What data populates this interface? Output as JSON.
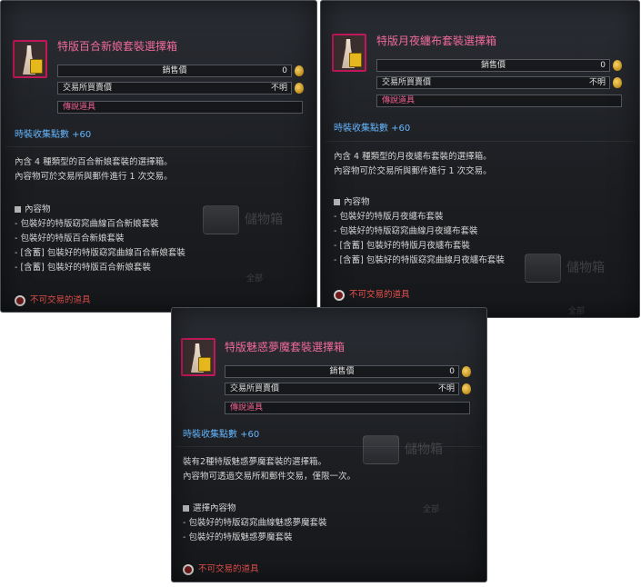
{
  "tooltips": [
    {
      "title": "特版百合新娘套裝選擇箱",
      "sell_price_label": "銷售價",
      "sell_price": "0",
      "exchange_price_label": "交易所買賣價",
      "exchange_price": "不明",
      "grade": "傳說道具",
      "fashion_points": "時裝收集點數 +60",
      "desc_lines": [
        "內含 4 種類型的百合新娘套裝的選擇箱。",
        "內容物可於交易所與郵件進行 1 次交易。"
      ],
      "contents_header": "內容物",
      "contents": [
        "- 包裝好的特版窈窕曲線百合新娘套裝",
        "- 包裝好的特版百合新娘套裝",
        "- [含蓄] 包裝好的特版窈窕曲線百合新娘套裝",
        "- [含蓄] 包裝好的特版百合新娘套裝"
      ],
      "untradeable": "不可交易的道具"
    },
    {
      "title": "特版月夜纏布套裝選擇箱",
      "sell_price_label": "銷售價",
      "sell_price": "0",
      "exchange_price_label": "交易所買賣價",
      "exchange_price": "不明",
      "grade": "傳說道具",
      "fashion_points": "時裝收集點數 +60",
      "desc_lines": [
        "內含 4 種類型的月夜纏布套裝的選擇箱。",
        "內容物可於交易所與郵件進行 1 次交易。"
      ],
      "contents_header": "內容物",
      "contents": [
        "- 包裝好的特版月夜纏布套裝",
        "- 包裝好的特版窈窕曲線月夜纏布套裝",
        "- [含蓄] 包裝好的特版月夜纏布套裝",
        "- [含蓄] 包裝好的特版窈窕曲線月夜纏布套裝"
      ],
      "untradeable": "不可交易的道具"
    },
    {
      "title": "特版魅惑夢魔套裝選擇箱",
      "sell_price_label": "銷售價",
      "sell_price": "0",
      "exchange_price_label": "交易所買賣價",
      "exchange_price": "不明",
      "grade": "傳說道具",
      "fashion_points": "時裝收集點數 +60",
      "desc_lines": [
        "裝有2種特版魅惑夢魔套裝的選擇箱。",
        "內容物可透過交易所和郵件交易，僅限一次。"
      ],
      "contents_header": "選擇內容物",
      "contents": [
        "- 包裝好的特版窈窕曲線魅惑夢魔套裝",
        "- 包裝好的特版魅惑夢魔套裝"
      ],
      "untradeable": "不可交易的道具"
    }
  ],
  "background": {
    "storage_label": "儲物箱",
    "all_label": "全部"
  },
  "colors": {
    "title": "#ef6a9b",
    "points": "#66b7ff",
    "untradeable": "#ef5350",
    "icon_border": "#c2185b"
  }
}
